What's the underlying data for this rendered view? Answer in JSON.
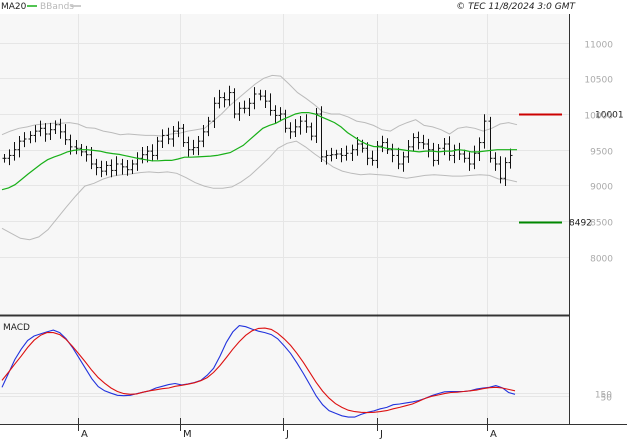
{
  "header": {
    "ma_label": "MA20",
    "bb_label": "BBands",
    "copyright": "© TEC 11/8/2024 3:0 GMT"
  },
  "panels": {
    "macd_label": "MACD"
  },
  "colors": {
    "ma": "#19b019",
    "bands": "#bbbbbb",
    "bars": "#111111",
    "macd": "#2233dd",
    "signal": "#dd1111",
    "resistance": "#cc0000",
    "support": "#008800",
    "grid": "#e6e6e6",
    "panel_bg": "#f7f7f7"
  },
  "chart_data": [
    {
      "type": "ohlc",
      "title": "",
      "ylim": [
        7200,
        11400
      ],
      "y_ticks": [
        8000,
        8500,
        9000,
        9500,
        10000,
        10500,
        11000
      ],
      "y_tick_labels": [
        "8000",
        "8500",
        "9000",
        "9500",
        "10000",
        "10500",
        "11000"
      ],
      "x_ticks": [
        "A",
        "M",
        "J",
        "J",
        "A"
      ],
      "resistance": {
        "value": 10001,
        "label": "10001"
      },
      "support": {
        "value": 8492,
        "label": "8492"
      },
      "grid": true,
      "bar_closes": [
        9380,
        9420,
        9500,
        9620,
        9650,
        9700,
        9760,
        9800,
        9720,
        9780,
        9850,
        9750,
        9640,
        9540,
        9520,
        9470,
        9430,
        9300,
        9250,
        9200,
        9280,
        9210,
        9300,
        9260,
        9220,
        9300,
        9380,
        9430,
        9480,
        9420,
        9620,
        9700,
        9650,
        9760,
        9800,
        9600,
        9500,
        9530,
        9620,
        9750,
        9900,
        10150,
        10230,
        10200,
        10300,
        10000,
        10080,
        10080,
        10150,
        10280,
        10250,
        10180,
        10050,
        9980,
        10000,
        9800,
        9750,
        9820,
        9900,
        9820,
        9690,
        10000,
        9400,
        9420,
        9430,
        9440,
        9420,
        9450,
        9500,
        9580,
        9520,
        9380,
        9350,
        9550,
        9600,
        9500,
        9420,
        9300,
        9400,
        9540,
        9670,
        9600,
        9580,
        9500,
        9350,
        9520,
        9580,
        9420,
        9500,
        9440,
        9380,
        9300,
        9450,
        9600,
        9900,
        9380,
        9300,
        9100,
        9320,
        9420
      ],
      "ma20": [
        8940,
        8965,
        9010,
        9085,
        9160,
        9230,
        9300,
        9360,
        9400,
        9430,
        9470,
        9490,
        9500,
        9500,
        9490,
        9480,
        9460,
        9445,
        9435,
        9415,
        9395,
        9375,
        9360,
        9345,
        9345,
        9350,
        9350,
        9370,
        9395,
        9395,
        9400,
        9405,
        9410,
        9420,
        9440,
        9460,
        9510,
        9560,
        9640,
        9720,
        9800,
        9840,
        9870,
        9920,
        9960,
        10000,
        10020,
        10020,
        10000,
        9960,
        9920,
        9880,
        9820,
        9740,
        9680,
        9620,
        9575,
        9545,
        9540,
        9520,
        9510,
        9505,
        9490,
        9480,
        9470,
        9480,
        9480,
        9470,
        9480,
        9480,
        9500,
        9490,
        9470,
        9470,
        9480,
        9490,
        9500,
        9500,
        9500,
        9500
      ],
      "bb_upper": [
        9710,
        9760,
        9800,
        9820,
        9850,
        9860,
        9870,
        9870,
        9880,
        9860,
        9810,
        9800,
        9760,
        9740,
        9710,
        9720,
        9710,
        9700,
        9700,
        9690,
        9720,
        9730,
        9760,
        9780,
        9800,
        9900,
        10000,
        10120,
        10220,
        10320,
        10420,
        10500,
        10540,
        10530,
        10420,
        10300,
        10220,
        10130,
        10030,
        10000,
        10000,
        9960,
        9900,
        9880,
        9840,
        9780,
        9760,
        9830,
        9880,
        9920,
        9840,
        9820,
        9780,
        9720,
        9800,
        9820,
        9800,
        9760,
        9800,
        9860,
        9880,
        9850
      ],
      "bb_lower": [
        8400,
        8330,
        8260,
        8240,
        8280,
        8380,
        8540,
        8700,
        8850,
        8990,
        9030,
        9090,
        9130,
        9150,
        9160,
        9180,
        9190,
        9180,
        9190,
        9170,
        9110,
        9040,
        8990,
        8960,
        8960,
        8980,
        9050,
        9140,
        9260,
        9380,
        9520,
        9590,
        9620,
        9540,
        9440,
        9350,
        9260,
        9200,
        9170,
        9150,
        9160,
        9150,
        9140,
        9120,
        9100,
        9120,
        9140,
        9150,
        9140,
        9130,
        9130,
        9140,
        9150,
        9140,
        9090,
        9080,
        9050
      ]
    },
    {
      "type": "line",
      "title": "",
      "ylim": [
        -700,
        2300
      ],
      "y_ticks": [
        50,
        150
      ],
      "y_tick_labels": [
        "50",
        "150"
      ],
      "series": [
        {
          "color_key": "macd",
          "values": [
            300,
            700,
            1100,
            1400,
            1650,
            1780,
            1840,
            1900,
            1950,
            1880,
            1700,
            1450,
            1150,
            850,
            550,
            320,
            200,
            130,
            70,
            60,
            70,
            120,
            160,
            200,
            280,
            330,
            380,
            410,
            370,
            400,
            440,
            500,
            650,
            850,
            1200,
            1600,
            1900,
            2080,
            2050,
            1980,
            1920,
            1880,
            1820,
            1700,
            1500,
            1280,
            1000,
            700,
            380,
            50,
            -200,
            -370,
            -450,
            -520,
            -560,
            -560,
            -480,
            -420,
            -380,
            -320,
            -280,
            -200,
            -180,
            -150,
            -120,
            -80,
            -20,
            60,
            120,
            170,
            180,
            180,
            180,
            200,
            250,
            280,
            300,
            350,
            290,
            150,
            100
          ]
        },
        {
          "color_key": "signal",
          "values": [
            500,
            730,
            970,
            1200,
            1450,
            1660,
            1800,
            1880,
            1880,
            1820,
            1680,
            1480,
            1260,
            1030,
            790,
            580,
            420,
            280,
            180,
            120,
            100,
            110,
            160,
            200,
            230,
            260,
            280,
            330,
            360,
            390,
            430,
            490,
            580,
            730,
            930,
            1160,
            1400,
            1620,
            1800,
            1930,
            2000,
            2010,
            1970,
            1860,
            1700,
            1510,
            1280,
            1020,
            730,
            440,
            190,
            -10,
            -170,
            -280,
            -360,
            -400,
            -420,
            -430,
            -420,
            -400,
            -370,
            -320,
            -280,
            -230,
            -180,
            -100,
            -20,
            40,
            80,
            120,
            150,
            160,
            180,
            200,
            220,
            260,
            290,
            300,
            280,
            240,
            200
          ]
        }
      ]
    }
  ]
}
